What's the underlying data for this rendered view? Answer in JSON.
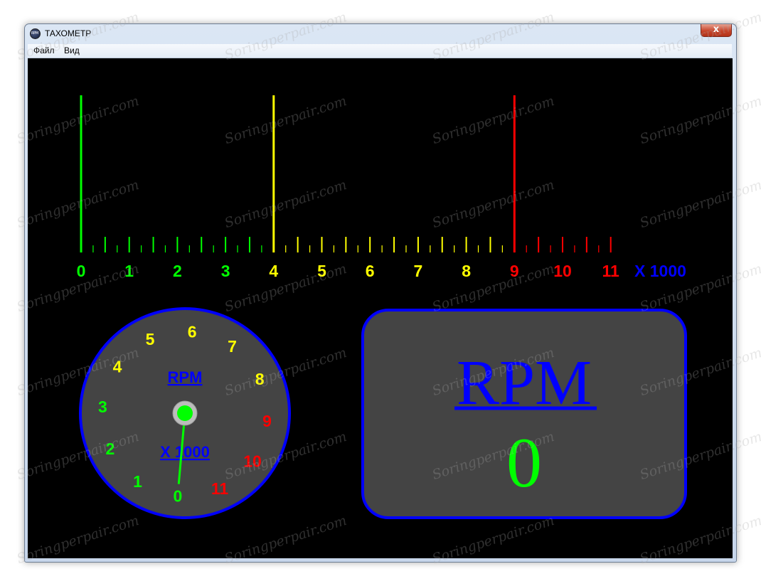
{
  "window": {
    "title": "ТАХОМЕТР",
    "icon_text": "RPM",
    "close_glyph": "x"
  },
  "menu": {
    "items": [
      {
        "label": "Файл"
      },
      {
        "label": "Вид"
      }
    ]
  },
  "colors": {
    "green": "#00ff00",
    "yellow": "#ffff00",
    "red": "#ff0000",
    "blue": "#0000ff",
    "panel_gray": "#444444"
  },
  "bar_scale": {
    "labels": [
      "0",
      "1",
      "2",
      "3",
      "4",
      "5",
      "6",
      "7",
      "8",
      "9",
      "10",
      "11"
    ],
    "label_colors": [
      "green",
      "green",
      "green",
      "green",
      "yellow",
      "yellow",
      "yellow",
      "yellow",
      "yellow",
      "red",
      "red",
      "red"
    ],
    "unit_label": "X 1000",
    "markers": [
      {
        "value": 0,
        "color": "green"
      },
      {
        "value": 4,
        "color": "yellow"
      },
      {
        "value": 9,
        "color": "red"
      }
    ]
  },
  "dial": {
    "labels": [
      "0",
      "1",
      "2",
      "3",
      "4",
      "5",
      "6",
      "7",
      "8",
      "9",
      "10",
      "11"
    ],
    "label_colors": [
      "green",
      "green",
      "green",
      "green",
      "yellow",
      "yellow",
      "yellow",
      "yellow",
      "yellow",
      "red",
      "red",
      "red"
    ],
    "top_label": "RPM",
    "bottom_label": "X 1000",
    "needle_value": 0
  },
  "digital": {
    "title": "RPM",
    "value": "0"
  },
  "watermark": {
    "text": "Soringperpair.com"
  }
}
